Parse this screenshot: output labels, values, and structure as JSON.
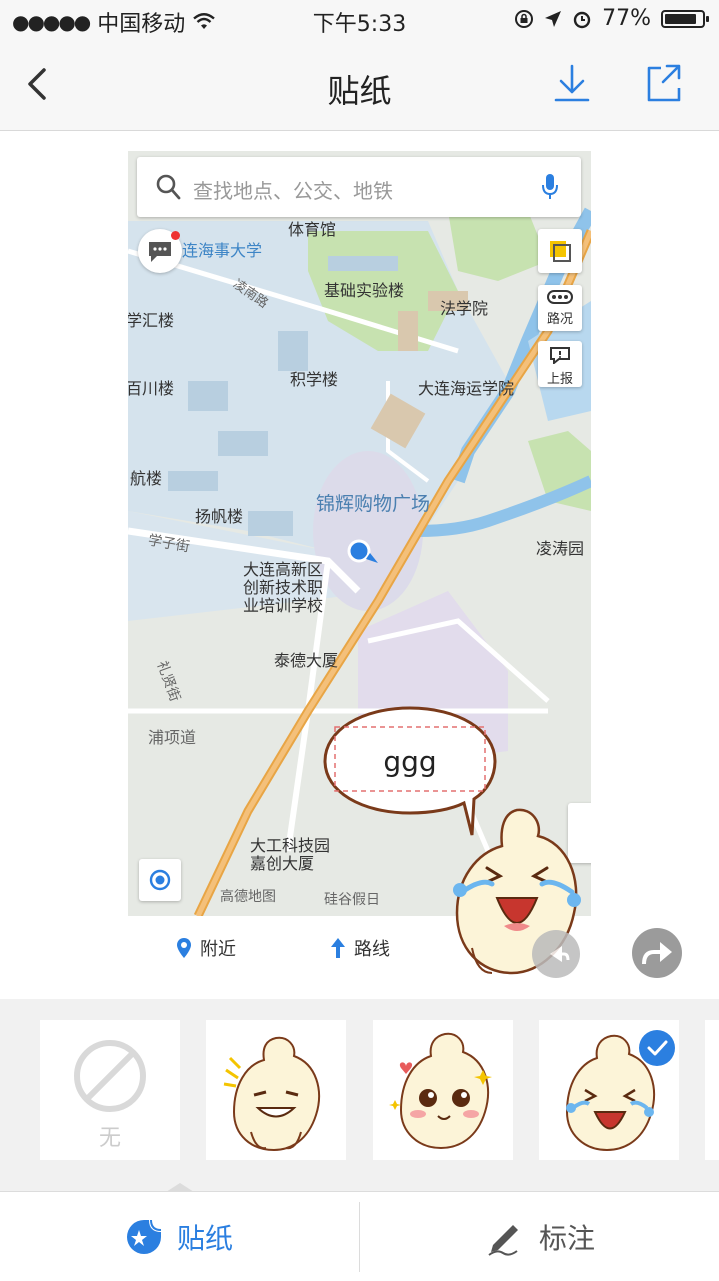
{
  "status_bar": {
    "carrier": "中国移动",
    "time": "下午5:33",
    "battery": "77%",
    "signal_dots": "●●●●●"
  },
  "nav": {
    "title": "贴纸"
  },
  "map": {
    "search_placeholder": "查找地点、公交、地铁",
    "traffic_label": "路况",
    "report_label": "上报",
    "labels": {
      "stadium": "体育馆",
      "university": "连海事大学",
      "lab": "基础实验楼",
      "law": "法学院",
      "xuehui": "学汇楼",
      "road_lingnan": "凌南路",
      "jixue": "积学楼",
      "baichuan": "百川楼",
      "maritime": "大连海运学院",
      "hang": "航楼",
      "yangfan": "扬帆楼",
      "mall": "锦辉购物广场",
      "xuezi": "学子街",
      "lingtao": "凌涛园",
      "school": "大连高新区\n创新技术职\n业培训学校",
      "taide": "泰德大厦",
      "lixian": "礼贤街",
      "puxiang": "浦项道",
      "dagong": "大工科技园\n嘉创大厦",
      "guigu": "硅谷假日",
      "gaode": "高德地图"
    }
  },
  "sticker_text": "ggg",
  "below_buttons": {
    "nearby": "附近",
    "route": "路线"
  },
  "sticker_picker": {
    "none_label": "无",
    "items": [
      "none",
      "mascot-grin",
      "mascot-love",
      "mascot-crying-laugh"
    ],
    "selected_index": 3
  },
  "tabs": {
    "sticker": "贴纸",
    "annotate": "标注"
  },
  "colors": {
    "accent": "#2b7fe0",
    "road": "#e8a545",
    "water": "#8fc3ea",
    "green": "#bfe3a4"
  }
}
